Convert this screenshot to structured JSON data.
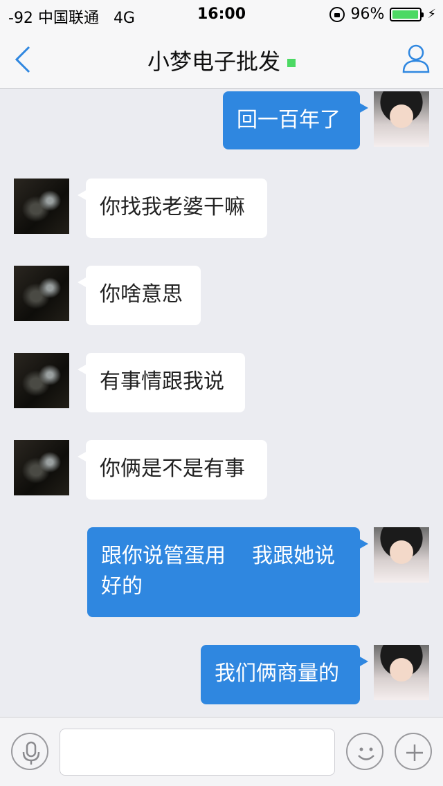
{
  "status_bar": {
    "signal": "-92",
    "carrier": "中国联通",
    "network": "4G",
    "time": "16:00",
    "battery_percent": "96%",
    "battery_level": 0.96
  },
  "nav": {
    "title": "小梦电子批发",
    "online_color": "#4cd964",
    "back_icon": "chevron-left-icon",
    "profile_icon": "person-icon"
  },
  "messages": [
    {
      "side": "out",
      "text": "回一百年了"
    },
    {
      "side": "in",
      "text": "你找我老婆干嘛"
    },
    {
      "side": "in",
      "text": "你啥意思"
    },
    {
      "side": "in",
      "text": "有事情跟我说"
    },
    {
      "side": "in",
      "text": "你俩是不是有事"
    },
    {
      "side": "out",
      "text_line1": "跟你说管蛋用    我跟她说",
      "text_line2": "好的"
    },
    {
      "side": "out",
      "text": "我们俩商量的"
    }
  ],
  "input_bar": {
    "placeholder": "",
    "icons": [
      "microphone-icon",
      "smiley-icon",
      "plus-icon"
    ]
  },
  "colors": {
    "outgoing_bubble": "#2f87e0",
    "incoming_bubble": "#ffffff",
    "accent": "#2f87e0"
  }
}
